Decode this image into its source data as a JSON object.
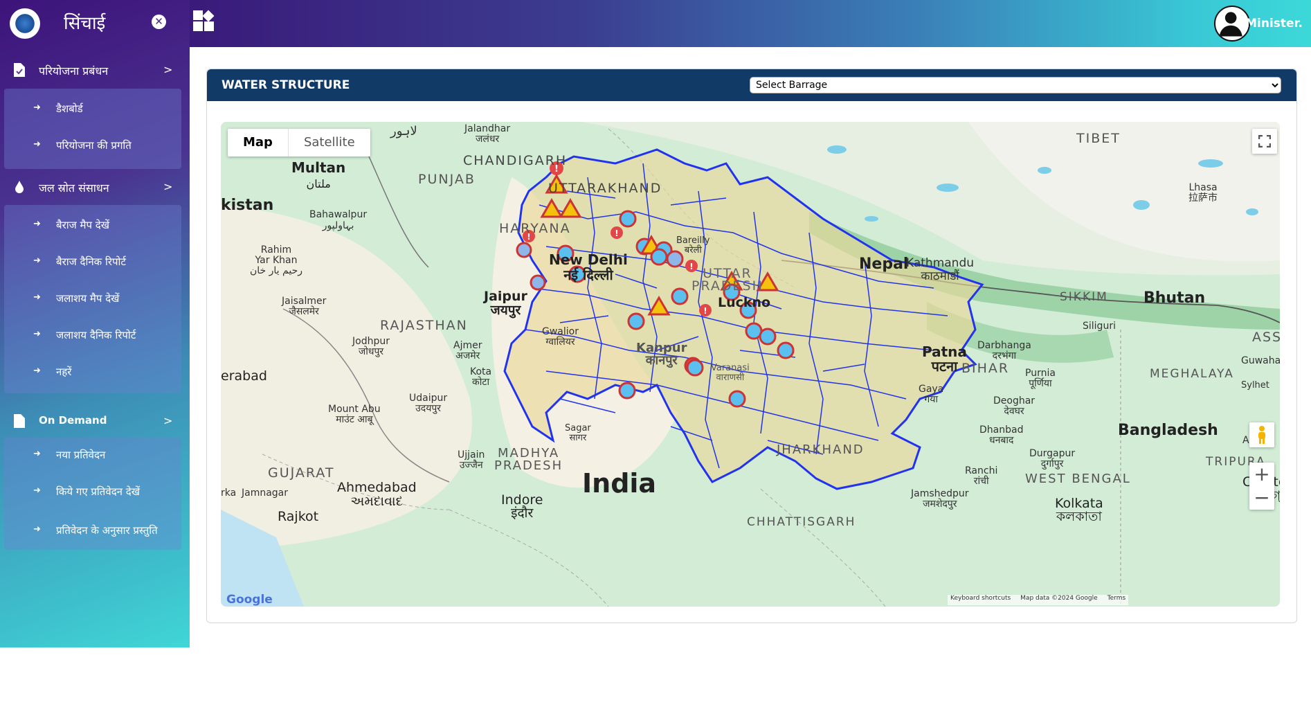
{
  "sidebar": {
    "title": "सिंचाई",
    "sections": [
      {
        "label": "परियोजना प्रबंधन",
        "items": [
          "डैशबोर्ड",
          "परियोजना की प्रगति"
        ]
      },
      {
        "label": "जल स्रोत संसाधन",
        "items": [
          "बैराज मैप देखें",
          "बैराज दैनिक रिपोर्ट",
          "जलाशय मैप देखें",
          "जलाशय दैनिक रिपोर्ट",
          "नहरें"
        ]
      },
      {
        "label": "On Demand",
        "items": [
          "नया प्रतिवेदन",
          "किये गए प्रतिवेदन देखें",
          "प्रतिवेदन के अनुसार प्रस्तुति"
        ]
      }
    ],
    "chevron": ">"
  },
  "header": {
    "user_name": "Minister."
  },
  "card": {
    "title": "WATER STRUCTURE",
    "select_value": "Select Barrage"
  },
  "map": {
    "type_map": "Map",
    "type_satellite": "Satellite",
    "zoom_in": "+",
    "zoom_out": "−",
    "logo": "Google",
    "attribution": {
      "shortcuts": "Keyboard shortcuts",
      "data": "Map data ©2024 Google",
      "terms": "Terms"
    },
    "places": {
      "jalandhar": "Jalandhar",
      "jalandhar_hi": "जलंधर",
      "lahore": "لاہور",
      "chandigarh": "CHANDIGARH",
      "punjab": "PUNJAB",
      "uttarakhand": "UTTARAKHAND",
      "multan": "Multan",
      "multan_ur": "ملتان",
      "pakistan": "kistan",
      "bahawalpur": "Bahawalpur",
      "bahawalpur_ur": "بہاولپور",
      "rahim": "Rahim",
      "yarkhan": "Yar Khan",
      "rahim_ur": "رحیم یار خان",
      "haryana": "HARYANA",
      "newdelhi": "New Delhi",
      "newdelhi_hi": "नई दिल्ली",
      "bareilly": "Bareilly",
      "bareilly_hi": "बरेली",
      "uttar": "UTTAR",
      "pradesh": "PRADESH",
      "lucknow": "Luckno",
      "nepal": "Nepal",
      "kathmandu": "Kathmandu",
      "kathmandu_ne": "काठमाडौं",
      "tibet": "TIBET",
      "lhasa": "Lhasa",
      "lhasa_bo": "拉萨市",
      "sikkim": "SIKKIM",
      "bhutan": "Bhutan",
      "siliguri": "Siliguri",
      "assam": "ASSA",
      "jaisalmer": "Jaisalmer",
      "jaisalmer_hi": "जैसलमेर",
      "rajasthan": "RAJASTHAN",
      "jaipur": "Jaipur",
      "jaipur_hi": "जयपुर",
      "jodhpur": "Jodhpur",
      "jodhpur_hi": "जोधपुर",
      "ajmer": "Ajmer",
      "ajmer_hi": "अजमेर",
      "gwalior": "Gwalior",
      "gwalior_hi": "ग्वालियर",
      "kanpur": "Kanpur",
      "kanpur_hi": "कानपुर",
      "patna": "Patna",
      "patna_hi": "पटना",
      "darbhanga": "Darbhanga",
      "darbhanga_hi": "दरभंगा",
      "bihar": "BIHAR",
      "purnia": "Purnia",
      "purnia_hi": "पूर्णिया",
      "guwahati": "Guwahati",
      "meghalaya": "MEGHALAYA",
      "sylhet": "Sylhet",
      "hyderabad": "erabad",
      "kota": "Kota",
      "kota_hi": "कोटा",
      "varanasi": "Varanasi",
      "varanasi_hi": "वाराणसी",
      "gaya": "Gaya",
      "gaya_hi": "गया",
      "deoghar": "Deoghar",
      "deoghar_hi": "देवघर",
      "mountabu": "Mount Abu",
      "mountabu_hi": "माउंट आबू",
      "udaipur": "Udaipur",
      "udaipur_hi": "उदयपुर",
      "sagar": "Sagar",
      "sagar_hi": "सागर",
      "dhanbad": "Dhanbad",
      "dhanbad_hi": "धनबाद",
      "bangladesh": "Bangladesh",
      "agartala": "Agarta",
      "jharkhand": "JHARKHAND",
      "durgapur": "Durgapur",
      "durgapur_hi": "दुर्गापुर",
      "tripura": "TRIPURA",
      "ujjain": "Ujjain",
      "ujjain_hi": "उज्जैन",
      "madhya": "MADHYA",
      "pradesh2": "PRADESH",
      "india": "India",
      "ranchi": "Ranchi",
      "ranchi_hi": "रांची",
      "westbengal": "WEST BENGAL",
      "chattogram": "Chattog",
      "chattogram_bn": "চট্টগ্",
      "gujarat": "GUJARAT",
      "ahmedabad": "Ahmedabad",
      "ahmedabad_gu": "અમદાવાદ",
      "jamnagar": "Jamnagar",
      "indore": "Indore",
      "indore_hi": "इंदौर",
      "jamshedpur": "Jamshedpur",
      "jamshedpur_hi": "जमशेदपुर",
      "kolkata": "Kolkata",
      "kolkata_bn": "কলকাতা",
      "chhattisgarh": "CHHATTISGARH",
      "rajkot": "Rajkot",
      "rka": "rka"
    }
  }
}
